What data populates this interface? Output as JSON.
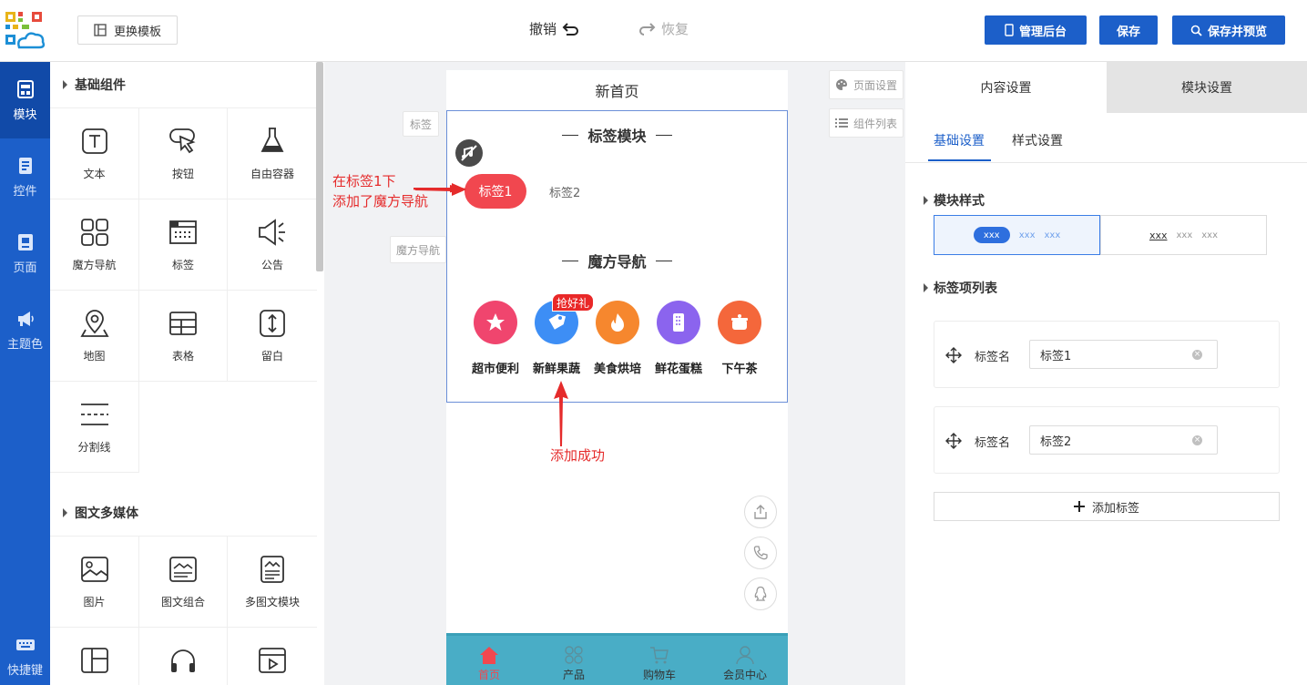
{
  "header": {
    "template_button": "更换模板",
    "undo": "撤销",
    "redo": "恢复",
    "admin_button": "管理后台",
    "save_button": "保存",
    "preview_button": "保存并预览"
  },
  "rail": [
    {
      "label": "模块",
      "icon": "module-icon",
      "active": true
    },
    {
      "label": "控件",
      "icon": "widget-icon"
    },
    {
      "label": "页面",
      "icon": "page-icon"
    },
    {
      "label": "主题色",
      "icon": "megaphone-icon"
    },
    {
      "label": "快捷键",
      "icon": "keyboard-icon"
    }
  ],
  "panel": {
    "basic_title": "基础组件",
    "basic_items": [
      "文本",
      "按钮",
      "自由容器",
      "魔方导航",
      "标签",
      "公告",
      "地图",
      "表格",
      "留白",
      "分割线"
    ],
    "media_title": "图文多媒体",
    "media_items": [
      "图片",
      "图文组合",
      "多图文模块",
      "拼图",
      "音频",
      "视频"
    ]
  },
  "canvas": {
    "page_settings": "页面设置",
    "component_list": "组件列表",
    "side_tag_label": "标签",
    "side_nav_label": "魔方导航",
    "page_title": "新首页",
    "tag_module_title": "标签模块",
    "tag1": "标签1",
    "tag2": "标签2",
    "nav_title": "魔方导航",
    "nav_items": [
      "超市便利",
      "新鲜果蔬",
      "美食烘培",
      "鲜花蛋糕",
      "下午茶"
    ],
    "badge": "抢好礼",
    "annot_line1": "在标签1下",
    "annot_line2": "添加了魔方导航",
    "annot_success": "添加成功",
    "tabbar": [
      "首页",
      "产品",
      "购物车",
      "会员中心"
    ]
  },
  "right": {
    "tab_content": "内容设置",
    "tab_module": "模块设置",
    "sub_basic": "基础设置",
    "sub_style": "样式设置",
    "module_style_title": "模块样式",
    "style_opt1_pill": "xxx",
    "style_opt1_rest1": "xxx",
    "style_opt1_rest2": "xxx",
    "style_opt2_a": "xxx",
    "style_opt2_b": "xxx",
    "style_opt2_c": "xxx",
    "tag_list_title": "标签项列表",
    "tag_name_label": "标签名",
    "tag_values": [
      "标签1",
      "标签2"
    ],
    "add_tag": "添加标签"
  },
  "colors": {
    "brand_blue": "#1c5fc9",
    "tag_red": "#f1474f",
    "tabbar_teal": "#49adc6",
    "annotation_red": "#e52b2b"
  }
}
